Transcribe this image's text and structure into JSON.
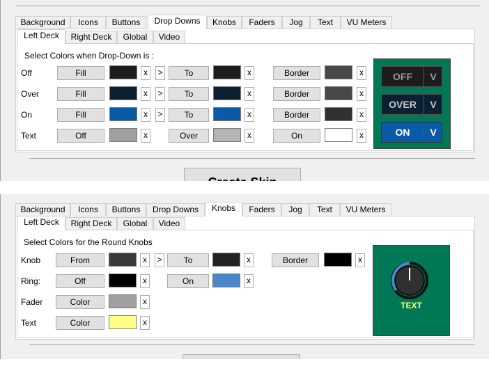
{
  "tabs": [
    "Background",
    "Icons",
    "Buttons",
    "Drop Downs",
    "Knobs",
    "Faders",
    "Jog",
    "Text",
    "VU Meters"
  ],
  "subtabs": [
    "Left Deck",
    "Right Deck",
    "Global",
    "Video"
  ],
  "panel1": {
    "active_tab": "Drop Downs",
    "heading": "Select Colors when Drop-Down is :",
    "rows": [
      {
        "label": "Off",
        "b1": "Fill",
        "c1": "#1c1c1c",
        "x": "x",
        "arrow": ">",
        "b2": "To",
        "c2": "#1c1c1c",
        "b3": "Border",
        "c3": "#484848"
      },
      {
        "label": "Over",
        "b1": "Fill",
        "c1": "#0b2030",
        "x": "x",
        "arrow": ">",
        "b2": "To",
        "c2": "#0b2030",
        "b3": "Border",
        "c3": "#484848"
      },
      {
        "label": "On",
        "b1": "Fill",
        "c1": "#0a5aa8",
        "x": "x",
        "arrow": ">",
        "b2": "To",
        "c2": "#0a5aa8",
        "b3": "Border",
        "c3": "#303030"
      },
      {
        "label": "Text",
        "b1": "Off",
        "c1": "#a0a0a0",
        "x": "x",
        "b2": "Over",
        "c2": "#b4b4b4",
        "b3": "On",
        "c3": "#ffffff"
      }
    ],
    "preview": [
      {
        "text": "OFF",
        "v": "V",
        "bg": "#1c1c1c",
        "fg": "#9a9a9a"
      },
      {
        "text": "OVER",
        "v": "V",
        "bg": "#0b2030",
        "fg": "#c8c8c8"
      },
      {
        "text": "ON",
        "v": "V",
        "bg": "#0a5aa8",
        "fg": "#ffffff"
      }
    ],
    "create_button": "Create Skin"
  },
  "panel2": {
    "active_tab": "Knobs",
    "heading": "Select Colors for the Round Knobs",
    "rows": [
      {
        "label": "Knob",
        "b1": "From",
        "c1": "#3a3a3a",
        "x": "x",
        "arrow": ">",
        "b2": "To",
        "c2": "#222222",
        "b3": "Border",
        "c3": "#000000"
      },
      {
        "label": "Ring:",
        "b1": "Off",
        "c1": "#000000",
        "x": "x",
        "b2": "On",
        "c2": "#4a86c8"
      },
      {
        "label": "Fader",
        "b1": "Color",
        "c1": "#a0a0a0",
        "x": "x"
      },
      {
        "label": "Text",
        "b1": "Color",
        "c1": "#ffff88",
        "x": "x"
      }
    ],
    "preview_text": "TEXT",
    "preview_text_color": "#ffff66",
    "preview_bg": "#007855"
  }
}
